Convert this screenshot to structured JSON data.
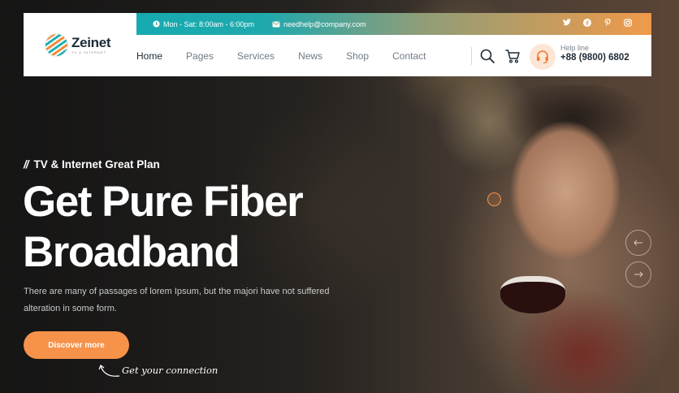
{
  "brand": {
    "name": "Zeinet",
    "tagline": "TV & INTERNET"
  },
  "topbar": {
    "hours": "Mon - Sat: 8:00am - 6:00pm",
    "email": "needhelp@company.com",
    "social": [
      "twitter-icon",
      "facebook-icon",
      "pinterest-icon",
      "instagram-icon"
    ]
  },
  "nav": {
    "items": [
      {
        "label": "Home",
        "active": true
      },
      {
        "label": "Pages"
      },
      {
        "label": "Services"
      },
      {
        "label": "News"
      },
      {
        "label": "Shop"
      },
      {
        "label": "Contact"
      }
    ]
  },
  "help": {
    "label": "Help line",
    "phone": "+88 (9800) 6802"
  },
  "hero": {
    "eyebrow": "TV & Internet Great Plan",
    "eyebrow_mark": "//",
    "headline_line1": "Get Pure Fiber",
    "headline_line2": "Broadband",
    "description": "There are many of passages of lorem Ipsum, but the majori have not suffered alteration in some form.",
    "cta_label": "Discover more",
    "script_note": "Get your connection"
  },
  "colors": {
    "accent_orange": "#f6924a",
    "accent_teal": "#16aab0",
    "dark_text": "#1d2b36"
  }
}
